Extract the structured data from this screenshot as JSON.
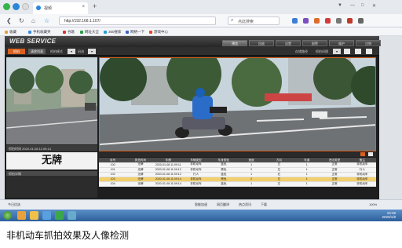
{
  "browser": {
    "tab_title": "视频",
    "url": "http://192.168.1.107/",
    "search_placeholder": "点此搜索",
    "bookmarks": [
      "收藏",
      "手机收藏夹",
      "谷歌",
      "网址大全",
      "360搜索",
      "网络一下",
      "游戏中心"
    ]
  },
  "app": {
    "logo": "WEB SERVICE",
    "main_tabs": [
      "预览",
      "回放",
      "设置",
      "报警",
      "维护",
      "注销"
    ],
    "active_main_tab": 0,
    "toolbar": {
      "btn_snapshot": "抓拍",
      "btn_record": "清除列表",
      "label_mode": "抓拍模式",
      "label_stream": "码流",
      "label_right": "存储路径",
      "label_speed": "抓拍间隔"
    },
    "snapshot_info": "抓拍时间 2020-01-08 11:09:14",
    "plate_text": "无牌",
    "left_panel_title": "抓拍详情",
    "table": {
      "headers": [
        "序号",
        "抓拍时间",
        "车牌",
        "车辆类型",
        "车身颜色",
        "速度",
        "方向",
        "车道",
        "违法类型",
        "备注"
      ],
      "rows": [
        [
          "100",
          "无牌",
          "2020-01-08 11:09:11",
          "非机动车",
          "蓝色",
          "1",
          "左",
          "1",
          "正常",
          "非机动车"
        ],
        [
          "101",
          "无牌",
          "2020-01-08 11:09:12",
          "非机动车",
          "黑色",
          "2",
          "左",
          "1",
          "正常",
          "行人"
        ],
        [
          "102",
          "无牌",
          "2020-01-08 11:09:12",
          "行人",
          "蓝色",
          "1",
          "右",
          "1",
          "正常",
          "非机动车"
        ],
        [
          "103",
          "无牌",
          "2020-01-08 11:09:14",
          "非机动车",
          "黑色",
          "2",
          "左",
          "1",
          "正常",
          "非机动车"
        ],
        [
          "104",
          "无牌",
          "2020-01-08 11:09:14",
          "非机动车",
          "蓝色",
          "1",
          "左",
          "1",
          "正常",
          "非机动车"
        ]
      ],
      "highlight_row": 3
    }
  },
  "taskbar_info": {
    "left": "今日优选",
    "items": [
      "智能加速",
      "网页翻译",
      "热点资讯",
      "下载",
      "100%"
    ]
  },
  "windows": {
    "time": "10:28",
    "date": "2020/1/8"
  },
  "caption": "非机动车抓拍效果及人像检测",
  "colors": {
    "accent": "#d9601e",
    "highlight_row": "#f2cf6b",
    "taskbar": "#2d5f9c"
  }
}
